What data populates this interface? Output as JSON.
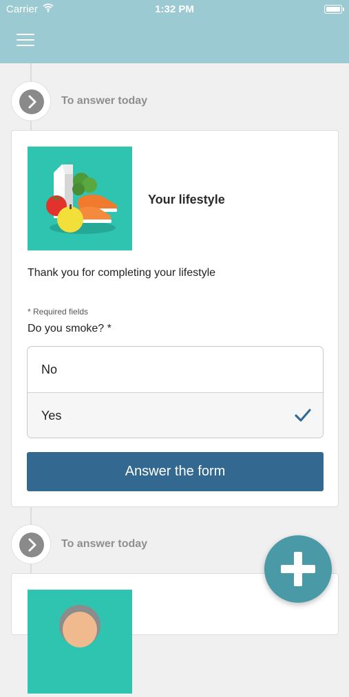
{
  "status_bar": {
    "carrier": "Carrier",
    "time": "1:32 PM"
  },
  "header": {
    "menu_icon": "hamburger-menu-icon",
    "background_color": "#9ccad3"
  },
  "timeline": [
    {
      "label": "To answer today",
      "card": {
        "image_icon": "lifestyle-food-sneakers-illustration",
        "title": "Your lifestyle",
        "intro_text": "Thank you for completing your lifestyle",
        "required_note": "* Required fields",
        "question": "Do you smoke? *",
        "options": [
          {
            "label": "No",
            "selected": false
          },
          {
            "label": "Yes",
            "selected": true
          }
        ],
        "answer_button": "Answer the form",
        "button_color": "#336890"
      }
    },
    {
      "label": "To answer today",
      "card": {
        "image_icon": "person-avatar-illustration"
      }
    }
  ],
  "fab": {
    "icon": "plus-icon",
    "color": "#4a99a7"
  }
}
